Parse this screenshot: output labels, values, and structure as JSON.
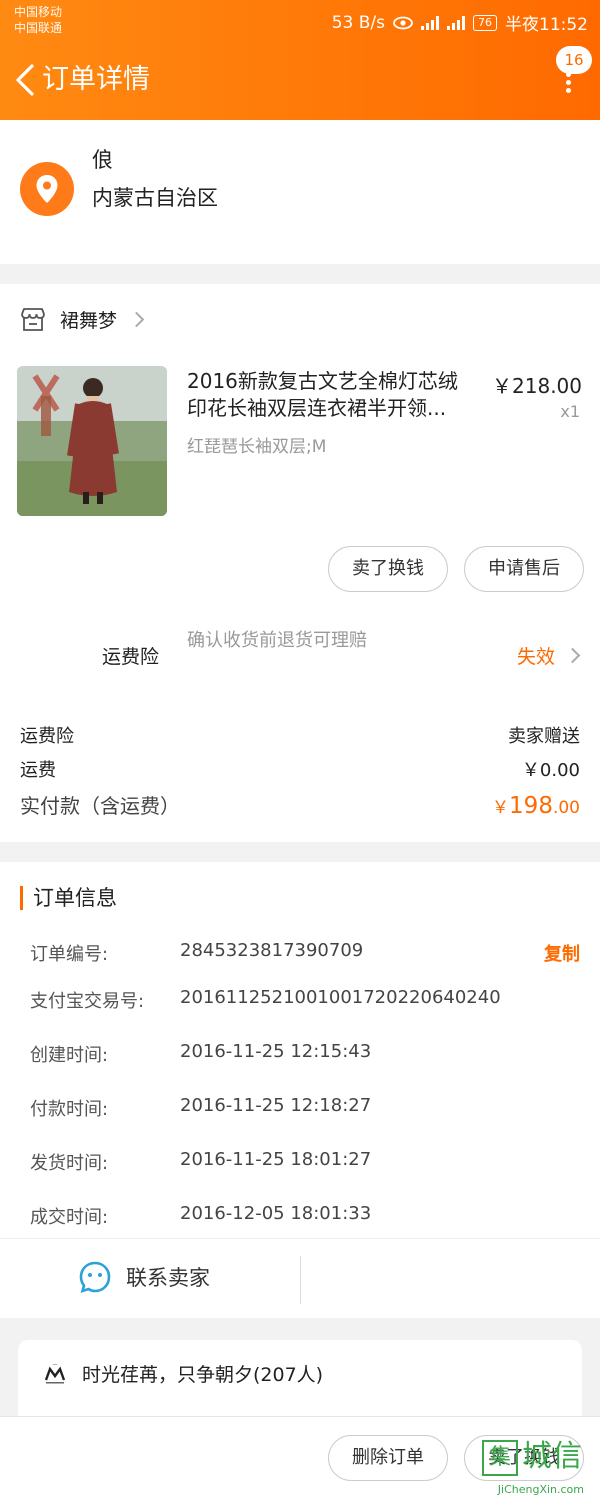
{
  "status_bar": {
    "carrier_1": "中国移动",
    "carrier_2": "中国联通",
    "speed": "53 B/s",
    "net_1": "2G",
    "net_2": "4G",
    "battery": "76",
    "time": "半夜11:52"
  },
  "header": {
    "title": "订单详情",
    "badge_count": "16",
    "bg_color": "#ff7a00"
  },
  "address": {
    "name": "俍",
    "region": "内蒙古自治区"
  },
  "store": {
    "name": "裙舞梦"
  },
  "product": {
    "title": "2016新款复古文艺全棉灯芯绒印花长袖双层连衣裙半开领...",
    "sku": "红琵琶长袖双层;M",
    "price": "￥218.00",
    "qty": "x1"
  },
  "actions": {
    "sell_label": "卖了换钱",
    "aftersale_label": "申请售后"
  },
  "insurance": {
    "label": "运费险",
    "desc": "确认收货前退货可理赔",
    "status": "失效"
  },
  "fees": {
    "insurance_label": "运费险",
    "insurance_value": "卖家赠送",
    "shipping_label": "运费",
    "shipping_value": "￥0.00",
    "paid_label": "实付款（含运费）",
    "paid_symbol": "￥",
    "paid_int": "198",
    "paid_dec": ".00"
  },
  "order_info": {
    "title": "订单信息",
    "copy_label": "复制",
    "rows": [
      {
        "label": "订单编号:",
        "value": "2845323817390709"
      },
      {
        "label": "支付宝交易号:",
        "value": "2016112521001001720220640240"
      },
      {
        "label": "创建时间:",
        "value": "2016-11-25 12:15:43"
      },
      {
        "label": "付款时间:",
        "value": "2016-11-25 12:18:27"
      },
      {
        "label": "发货时间:",
        "value": "2016-11-25 18:01:27"
      },
      {
        "label": "成交时间:",
        "value": "2016-12-05 18:01:33"
      }
    ],
    "contact_label": "联系卖家"
  },
  "group": {
    "text": "时光荏苒，只争朝夕(207人)"
  },
  "bottom": {
    "delete_label": "删除订单",
    "sell_label": "卖了换钱"
  },
  "watermark": {
    "box": "集",
    "cn": "城信",
    "url": "JiChengXin.com"
  },
  "colors": {
    "accent": "#ff6a00",
    "link_blue": "#2aa1d8"
  }
}
